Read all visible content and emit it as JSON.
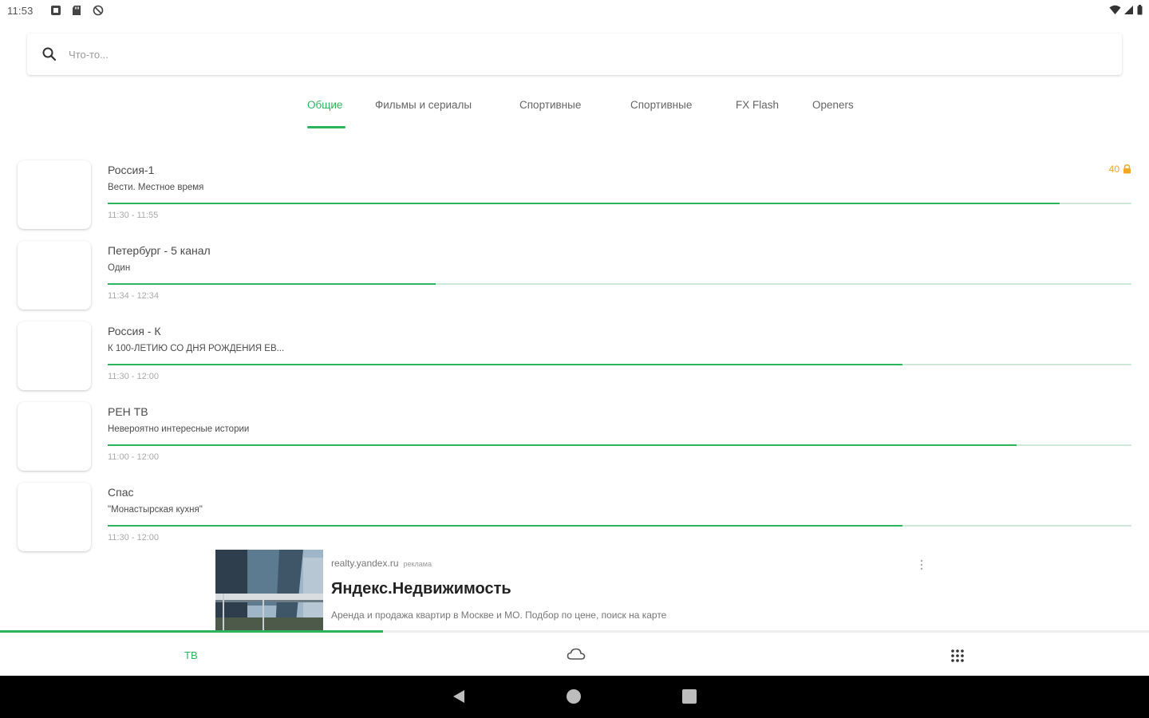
{
  "status_bar": {
    "time": "11:53",
    "left_icons": [
      "notification-icon",
      "sd-card-icon",
      "blocked-icon"
    ],
    "right_icons": [
      "wifi-icon",
      "signal-icon",
      "battery-icon"
    ]
  },
  "search": {
    "placeholder": "Что-то...",
    "value": ""
  },
  "tabs": [
    {
      "label": "Общие",
      "active": true
    },
    {
      "label": "Фильмы и сериалы",
      "active": false
    },
    {
      "label": "Спортивные",
      "active": false
    },
    {
      "label": "Спортивные",
      "active": false
    },
    {
      "label": "FX Flash",
      "active": false
    },
    {
      "label": "Openers",
      "active": false
    }
  ],
  "channels": [
    {
      "name": "Россия-1",
      "program": "Вести. Местное время",
      "time": "11:30 - 11:55",
      "progress": 0.93,
      "rating": "40"
    },
    {
      "name": "Петербург - 5 канал",
      "program": "Один",
      "time": "11:34 - 12:34",
      "progress": 0.32,
      "rating": ""
    },
    {
      "name": "Россия - К",
      "program": "К 100-ЛЕТИЮ СО ДНЯ РОЖДЕНИЯ ЕВ...",
      "time": "11:30 - 12:00",
      "progress": 0.776,
      "rating": ""
    },
    {
      "name": "РЕН ТВ",
      "program": "Невероятно интересные истории",
      "time": "11:00 - 12:00",
      "progress": 0.888,
      "rating": ""
    },
    {
      "name": "Спас",
      "program": "\"Монастырская кухня\"",
      "time": "11:30 - 12:00",
      "progress": 0.776,
      "rating": ""
    }
  ],
  "ad": {
    "domain": "realty.yandex.ru",
    "label": "реклама",
    "title": "Яндекс.Недвижимость",
    "description": "Аренда и продажа квартир в Москве и МО. Подбор по цене, поиск на карте"
  },
  "bottom_nav": {
    "tv_label": "ТВ",
    "progress": 0.333,
    "items": [
      "tv",
      "cloud-icon",
      "grid-icon"
    ]
  },
  "colors": {
    "accent": "#2db55d",
    "rating": "#f5a623"
  }
}
